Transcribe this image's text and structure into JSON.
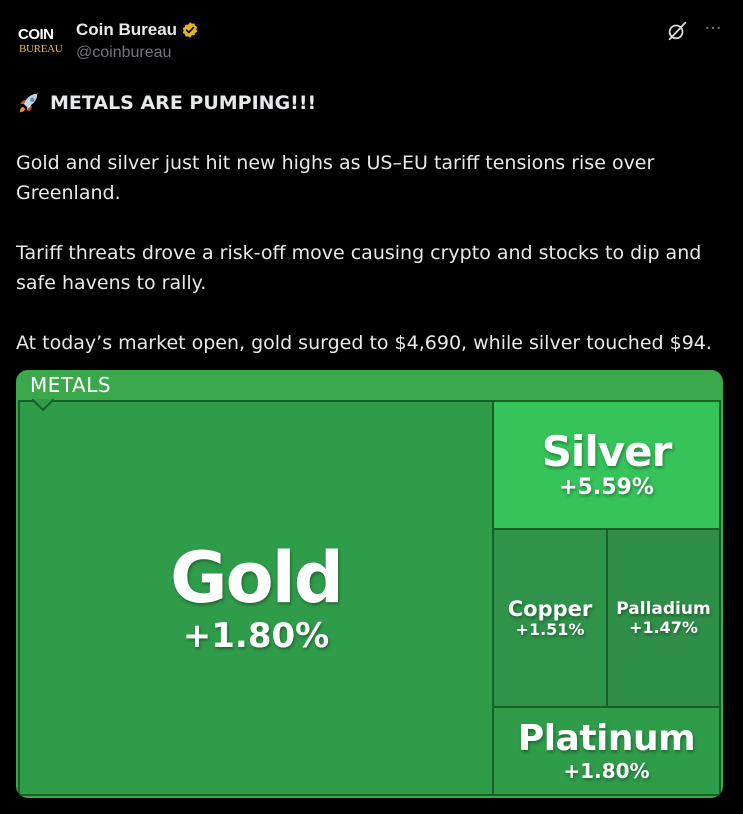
{
  "author": {
    "avatar": {
      "line1": "COIN",
      "line2": "BUREAU"
    },
    "display_name": "Coin Bureau",
    "handle": "@coinbureau",
    "verified_icon": "verified-gold-badge-icon"
  },
  "actions": {
    "grok_icon": "grok-icon",
    "more_label": "···"
  },
  "post": {
    "headline": "METALS ARE PUMPING!!!",
    "headline_icon": "rocket-icon",
    "paragraphs": [
      "Gold and silver just hit new highs as US–EU tariff tensions rise over Greenland.",
      "Tariff threats drove a risk-off move causing crypto and stocks to dip and safe havens to rally.",
      "At today’s market open, gold surged to $4,690, while silver touched $94."
    ]
  },
  "treemap": {
    "header": "METALS",
    "colors": {
      "header": "#3aa84b",
      "gold": "#2f9c4a",
      "silver": "#35c35a",
      "copper": "#2f9349",
      "palladium": "#2f8f48",
      "platinum": "#2f9c4a",
      "border": "#1b5e27"
    },
    "tiles": {
      "gold": {
        "name": "Gold",
        "change": "+1.80%"
      },
      "silver": {
        "name": "Silver",
        "change": "+5.59%"
      },
      "copper": {
        "name": "Copper",
        "change": "+1.51%"
      },
      "palladium": {
        "name": "Palladium",
        "change": "+1.47%"
      },
      "platinum": {
        "name": "Platinum",
        "change": "+1.80%"
      }
    }
  }
}
